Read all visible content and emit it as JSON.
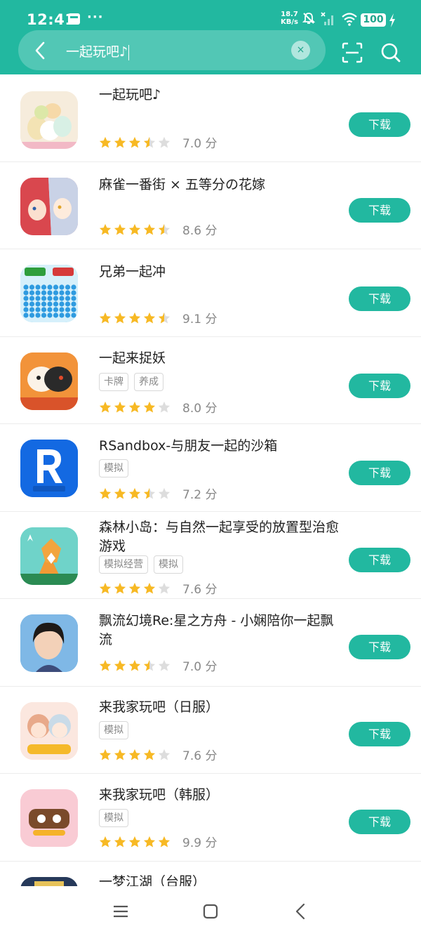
{
  "status": {
    "time": "12:41",
    "dots": "···",
    "net_speed_value": "18.7",
    "net_speed_unit": "KB/s",
    "battery": "100"
  },
  "search": {
    "query": "一起玩吧♪",
    "clear": "×"
  },
  "apps": [
    {
      "name": "一起玩吧♪",
      "tags": [],
      "rating": 3.5,
      "score": "7.0 分",
      "download": "下载",
      "icon": "sumikko-icon",
      "color": "#f4e9d8"
    },
    {
      "name": "麻雀一番街 × 五等分の花嫁",
      "tags": [],
      "rating": 4.5,
      "score": "8.6 分",
      "download": "下载",
      "icon": "anime-girls-icon",
      "color": "#c84a55"
    },
    {
      "name": "兄弟一起冲",
      "tags": [],
      "rating": 4.5,
      "score": "9.1 分",
      "download": "下载",
      "icon": "crowd-runner-icon",
      "color": "#6cc9ef"
    },
    {
      "name": "一起来捉妖",
      "tags": [
        "卡牌",
        "养成"
      ],
      "rating": 4,
      "score": "8.0 分",
      "download": "下载",
      "icon": "monster-icon",
      "color": "#f08c2a"
    },
    {
      "name": "RSandbox-与朋友一起的沙箱",
      "tags": [
        "模拟"
      ],
      "rating": 3.5,
      "score": "7.2 分",
      "download": "下载",
      "icon": "rsandbox-icon",
      "color": "#1a6fe0"
    },
    {
      "name": "森林小岛：与自然一起享受的放置型治愈游戏",
      "tags": [
        "模拟经营",
        "模拟"
      ],
      "rating": 4,
      "score": "7.6 分",
      "download": "下载",
      "icon": "fox-icon",
      "color": "#5fd0c6"
    },
    {
      "name": "飘流幻境Re:星之方舟 - 小娴陪你一起飘流",
      "tags": [],
      "rating": 3.5,
      "score": "7.0 分",
      "download": "下载",
      "icon": "portrait-icon",
      "color": "#5aa4d8"
    },
    {
      "name": "来我家玩吧（日服）",
      "tags": [
        "模拟"
      ],
      "rating": 4,
      "score": "7.6 分",
      "download": "下载",
      "icon": "chibi-couple-icon",
      "color": "#f6d5c8"
    },
    {
      "name": "来我家玩吧（韩服）",
      "tags": [
        "模拟"
      ],
      "rating": 5,
      "score": "9.9 分",
      "download": "下载",
      "icon": "korean-logo-icon",
      "color": "#f8c6cf"
    },
    {
      "name": "一梦江湖（台服）",
      "tags": [],
      "rating": 0,
      "score": "",
      "download": "",
      "icon": "wuxia-icon",
      "color": "#2b3d5b"
    }
  ],
  "colors": {
    "accent": "#22b8a0",
    "star": "#f7b924",
    "star_empty": "#dddddd"
  }
}
